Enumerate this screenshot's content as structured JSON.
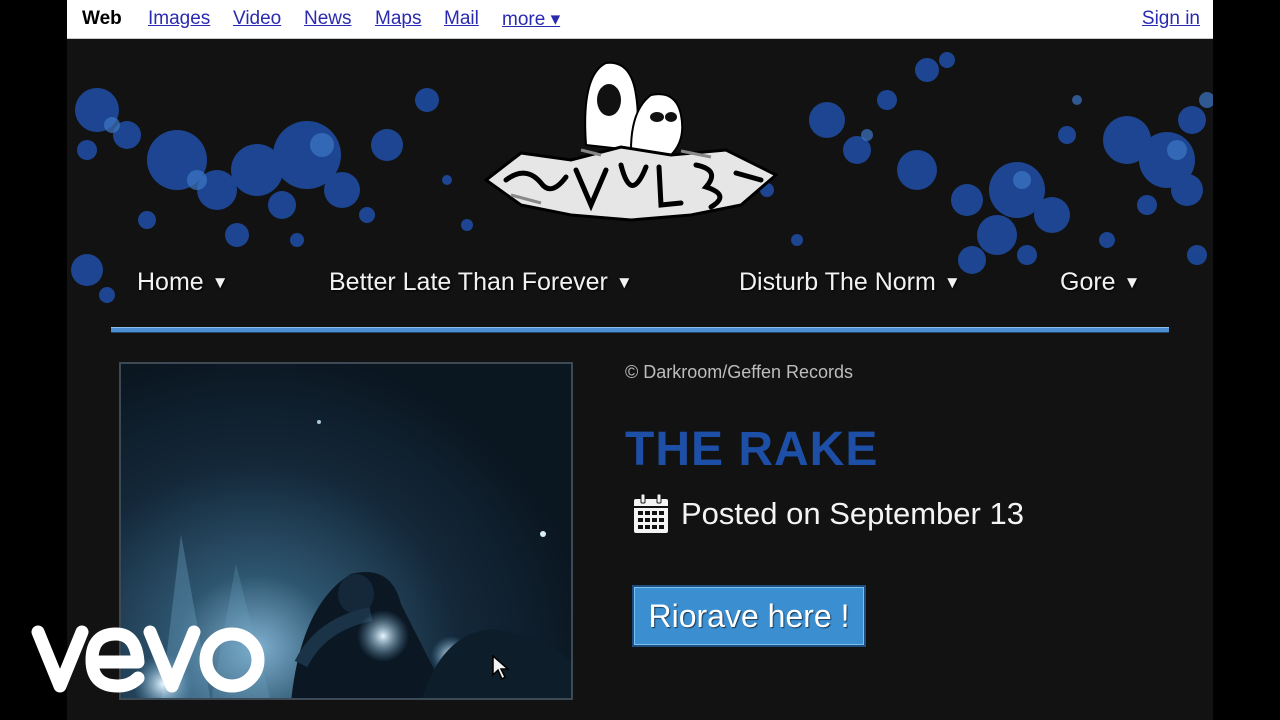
{
  "topbar": {
    "active": "Web",
    "links": [
      "Images",
      "Video",
      "News",
      "Maps",
      "Mail"
    ],
    "more": "more ▾",
    "sign_in": "Sign in",
    "link_color": "#2a2ab0"
  },
  "menu": {
    "items": [
      {
        "label": "Home",
        "caret": "▼"
      },
      {
        "label": "Better Late Than Forever",
        "caret": "▼"
      },
      {
        "label": "Disturb The Norm",
        "caret": "▼"
      },
      {
        "label": "Gore",
        "caret": "▼"
      }
    ],
    "line_color": "#4c8fd2"
  },
  "logo": {
    "icon": "graffiti-logo"
  },
  "content": {
    "copyright": "© Darkroom/Geffen Records",
    "title": "THE RAKE",
    "posted": "Posted on September 13",
    "posted_icon": "calendar-icon",
    "cta": "Riorave here !",
    "title_color": "#1d4fa6",
    "cta_color": "#3b8fd0"
  },
  "watermark": {
    "text": "vevo"
  }
}
